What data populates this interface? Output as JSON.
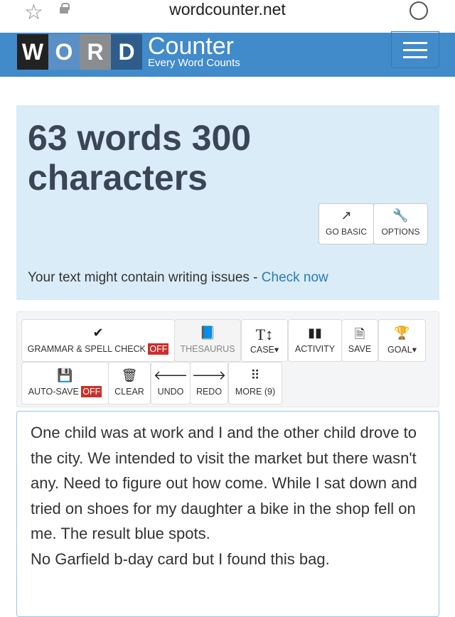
{
  "browser": {
    "url": "wordcounter.net",
    "icons": [
      "star-icon",
      "lock-icon",
      "reload-icon"
    ]
  },
  "header": {
    "logo_letters": [
      "W",
      "O",
      "R",
      "D"
    ],
    "logo_word": "Counter",
    "tagline": "Every Word Counts",
    "brand_color": "#418bca",
    "menu_icon": "hamburger-icon"
  },
  "stats": {
    "summary": "63 words 300 characters",
    "buttons": [
      {
        "label": "GO BASIC",
        "icon": "external-link-icon"
      },
      {
        "label": "OPTIONS",
        "icon": "wrench-icon"
      }
    ],
    "issue_text": "Your text might contain writing issues - ",
    "issue_link": "Check now"
  },
  "toolbar": {
    "row1": [
      {
        "label": "GRAMMAR & SPELL CHECK",
        "badge": "OFF",
        "icon": "check-icon"
      },
      {
        "label": "THESAURUS",
        "icon": "book-icon"
      },
      {
        "label": "CASE",
        "icon": "text-case-icon"
      },
      {
        "label": "ACTIVITY",
        "icon": "bar-chart-icon"
      },
      {
        "label": "SAVE",
        "icon": "save-file-icon"
      },
      {
        "label": "GOAL",
        "icon": "trophy-icon"
      }
    ],
    "row2": [
      {
        "label": "AUTO-SAVE",
        "badge": "OFF",
        "icon": "floppy-icon"
      },
      {
        "label": "CLEAR",
        "icon": "trash-icon"
      },
      {
        "label": "UNDO",
        "icon": "arrow-left-icon"
      },
      {
        "label": "REDO",
        "icon": "arrow-right-icon"
      },
      {
        "label": "MORE (9)",
        "icon": "grid-icon"
      }
    ]
  },
  "editor": {
    "text": "One child was at work and I and the other child drove to the city. We intended to visit the market but there wasn't any. Need to figure out how come. While I sat down and tried on shoes for my daughter a bike in the shop fell on me. The result blue spots.\nNo Garfield b-day card but I found this bag."
  }
}
